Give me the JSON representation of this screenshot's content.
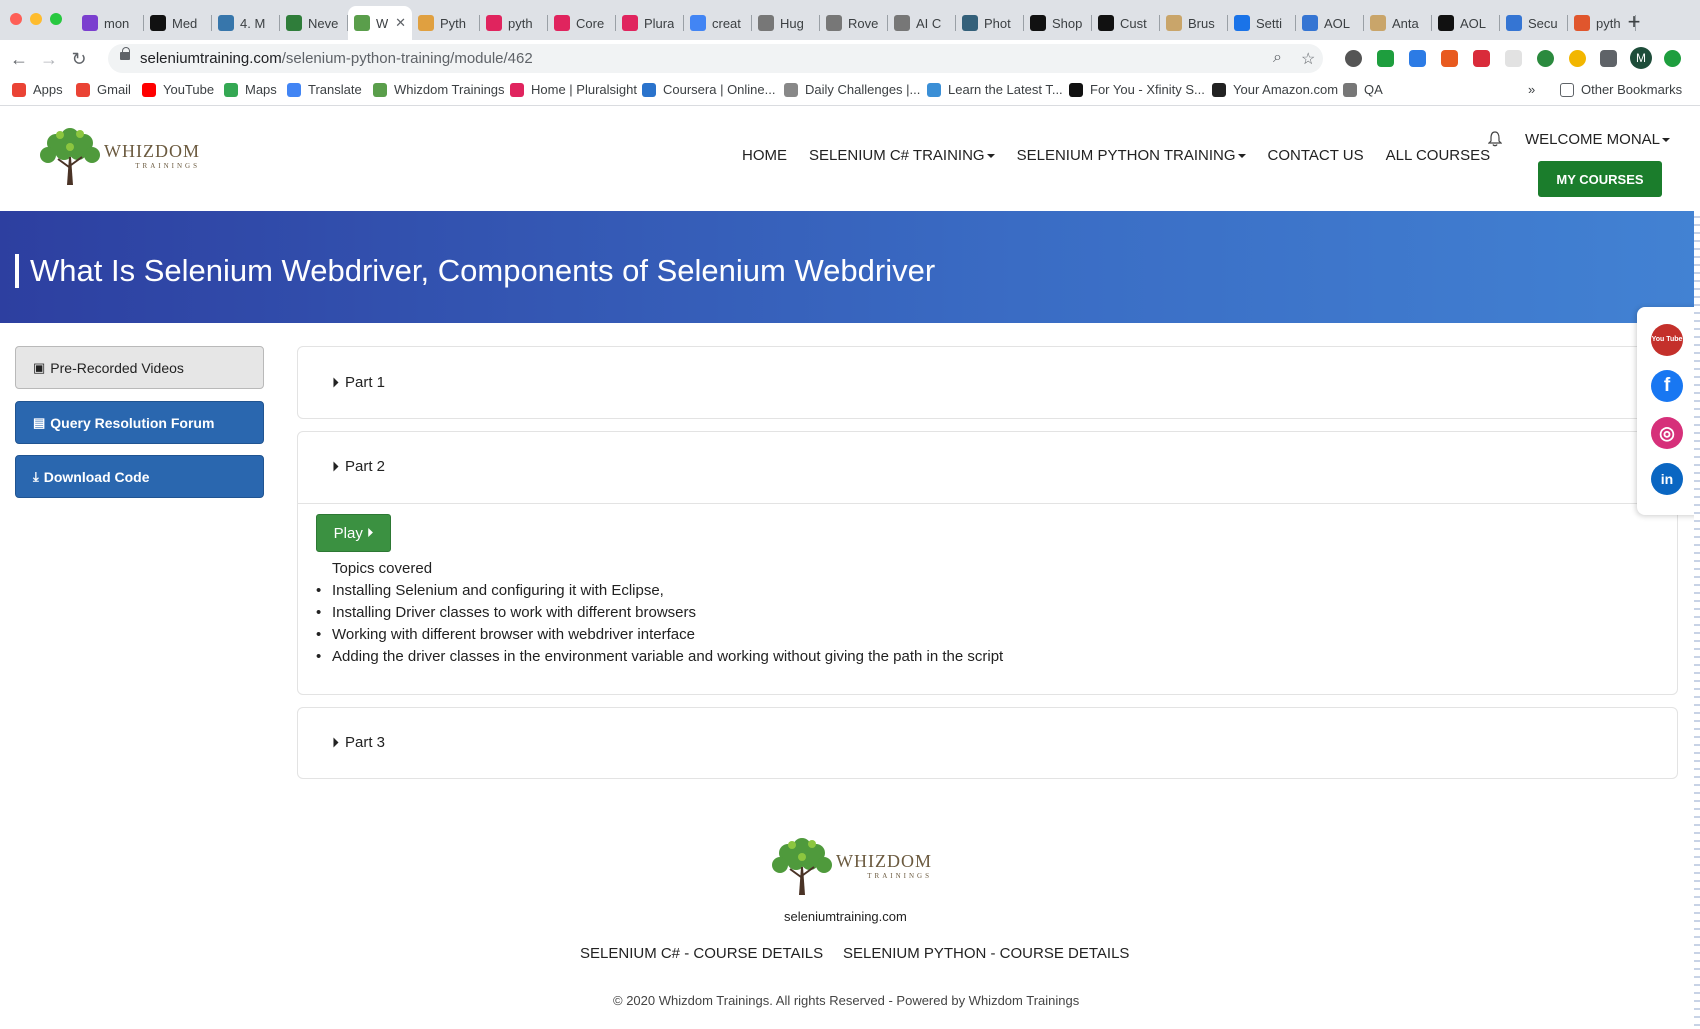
{
  "browser": {
    "tabs": [
      {
        "label": "mon",
        "fav": "mail",
        "color": "#7b3fcf"
      },
      {
        "label": "Med",
        "fav": "ID",
        "color": "#111"
      },
      {
        "label": "4. M",
        "fav": "py",
        "color": "#3776ab"
      },
      {
        "label": "Neve",
        "fav": "tri",
        "color": "#2f7d3a"
      },
      {
        "label": "W",
        "fav": "tree",
        "color": "#5a9e4b",
        "active": true
      },
      {
        "label": "Pyth",
        "fav": "hand",
        "color": "#e0a040"
      },
      {
        "label": "pyth",
        "fav": "pl",
        "color": "#e0245e"
      },
      {
        "label": "Core",
        "fav": "pl",
        "color": "#e0245e"
      },
      {
        "label": "Plura",
        "fav": "pl",
        "color": "#e0245e"
      },
      {
        "label": "creat",
        "fav": "G",
        "color": "#4285f4"
      },
      {
        "label": "Hug",
        "fav": "RC",
        "color": "#777"
      },
      {
        "label": "Rove",
        "fav": "RC",
        "color": "#777"
      },
      {
        "label": "AI C",
        "fav": "RC",
        "color": "#777"
      },
      {
        "label": "Phot",
        "fav": "ph",
        "color": "#34607a"
      },
      {
        "label": "Shop",
        "fav": "ID",
        "color": "#111"
      },
      {
        "label": "Cust",
        "fav": "ID",
        "color": "#111"
      },
      {
        "label": "Brus",
        "fav": "br",
        "color": "#c9a56a"
      },
      {
        "label": "Setti",
        "fav": "gear",
        "color": "#1a73e8"
      },
      {
        "label": "AOL",
        "fav": "Aol",
        "color": "#3575d3"
      },
      {
        "label": "Anta",
        "fav": "an",
        "color": "#c9a56a"
      },
      {
        "label": "AOL",
        "fav": "Aol",
        "color": "#111"
      },
      {
        "label": "Secu",
        "fav": "Aol",
        "color": "#3575d3"
      },
      {
        "label": "pyth",
        "fav": "py",
        "color": "#e0562d"
      }
    ],
    "tab_close": "✕",
    "new_tab": "+",
    "url_host": "seleniumtraining.com",
    "url_path": "/selenium-python-training/module/462",
    "profile_initial": "M",
    "bookmarks": [
      {
        "label": "Apps",
        "color": "#ea4335"
      },
      {
        "label": "Gmail",
        "color": "#ea4335"
      },
      {
        "label": "YouTube",
        "color": "#ff0000"
      },
      {
        "label": "Maps",
        "color": "#34a853"
      },
      {
        "label": "Translate",
        "color": "#4285f4"
      },
      {
        "label": "Whizdom Trainings",
        "color": "#5a9e4b"
      },
      {
        "label": "Home | Pluralsight",
        "color": "#e0245e"
      },
      {
        "label": "Coursera | Online...",
        "color": "#2a73cc"
      },
      {
        "label": "Daily Challenges |...",
        "color": "#888"
      },
      {
        "label": "Learn the Latest T...",
        "color": "#3b8fd6"
      },
      {
        "label": "For You - Xfinity S...",
        "color": "#111"
      },
      {
        "label": "Your Amazon.com",
        "color": "#222"
      },
      {
        "label": "QA",
        "color": "#777"
      }
    ],
    "bookmarks_more": "»",
    "other_bookmarks": "Other Bookmarks"
  },
  "site": {
    "brand": "WHIZDOM",
    "brand_sub": "TRAININGS",
    "nav": [
      {
        "label": "HOME",
        "caret": false
      },
      {
        "label": "SELENIUM C# TRAINING",
        "caret": true
      },
      {
        "label": "SELENIUM PYTHON TRAINING",
        "caret": true
      },
      {
        "label": "CONTACT US",
        "caret": false
      },
      {
        "label": "ALL COURSES",
        "caret": false
      }
    ],
    "welcome": "WELCOME MONAL",
    "my_courses": "MY COURSES"
  },
  "banner": {
    "title": "What Is Selenium Webdriver, Components of Selenium Webdriver"
  },
  "sidebar": {
    "items": [
      {
        "label": "Pre-Recorded Videos",
        "icon": "▣"
      },
      {
        "label": "Query Resolution Forum",
        "icon": "▤"
      },
      {
        "label": "Download Code",
        "icon": "⤓"
      }
    ]
  },
  "accordion": {
    "part1": "Part 1",
    "part2": "Part 2",
    "part3": "Part 3",
    "play_label": "Play",
    "topics_heading": "Topics covered",
    "topics": [
      "Installing Selenium and configuring it with Eclipse,",
      "Installing Driver classes to work with different browsers",
      "Working with different browser with webdriver interface",
      "Adding the driver classes in the environment variable and working without giving the path in the script"
    ]
  },
  "social": {
    "youtube_label": "You Tube",
    "facebook_label": "f",
    "instagram_label": "◎",
    "linkedin_label": "in",
    "colors": {
      "youtube": "#c4302b",
      "facebook": "#1877f2",
      "instagram": "#d6307a",
      "linkedin": "#0a66c2"
    }
  },
  "footer": {
    "domain": "seleniumtraining.com",
    "link_csharp": "SELENIUM C# - COURSE DETAILS",
    "link_python": "SELENIUM PYTHON - COURSE DETAILS",
    "copyright": "© 2020 Whizdom Trainings. All rights Reserved - Powered by Whizdom Trainings"
  }
}
